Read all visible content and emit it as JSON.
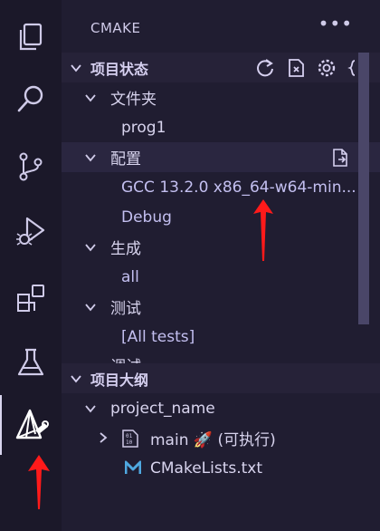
{
  "sidebar": {
    "title": "CMAKE",
    "more_label": "•••",
    "project_status": {
      "section_label": "项目状态",
      "folder_label": "文件夹",
      "folder_value": "prog1",
      "config_label": "配置",
      "kit_value": "GCC 13.2.0 x86_64-w64-min...",
      "build_type": "Debug",
      "build_label": "生成",
      "build_target": "all",
      "test_label": "测试",
      "test_value": "[All tests]",
      "partial_label": "调试"
    },
    "outline": {
      "section_label": "项目大纲",
      "project_name": "project_name",
      "target_name": "main 🚀 (可执行)",
      "file_name": "CMakeLists.txt"
    }
  },
  "colors": {
    "accent": "#ff1a1a",
    "bg": "#1e1b2e"
  },
  "icons": [
    "files-icon",
    "search-icon",
    "source-control-icon",
    "run-debug-icon",
    "extensions-icon",
    "testing-icon",
    "cmake-icon"
  ]
}
